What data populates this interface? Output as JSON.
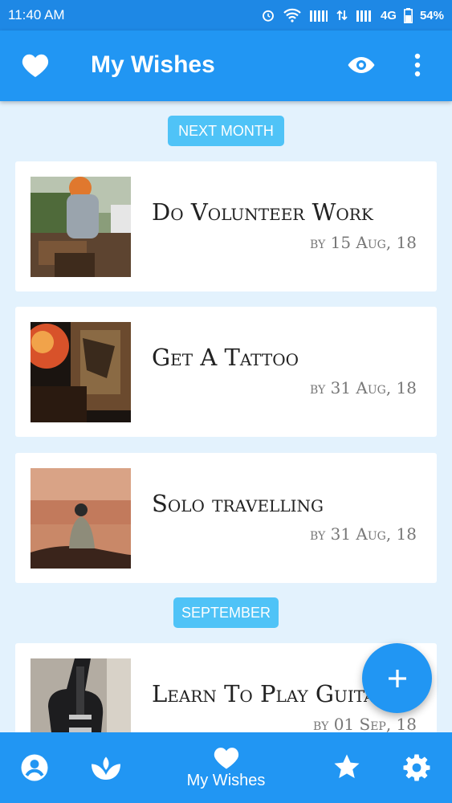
{
  "status_bar": {
    "time": "11:40 AM",
    "network": "4G",
    "battery": "54%"
  },
  "app_bar": {
    "title": "My Wishes"
  },
  "sections": [
    {
      "label": "NEXT MONTH",
      "items": [
        {
          "title": "Do Volunteer Work",
          "date": "by 15 Aug, 18"
        },
        {
          "title": "Get A Tattoo",
          "date": "by 31 Aug, 18"
        },
        {
          "title": "Solo travelling",
          "date": "by 31 Aug, 18"
        }
      ]
    },
    {
      "label": "SEPTEMBER",
      "items": [
        {
          "title": "Learn To Play Guitar",
          "date": "by 01 Sep, 18"
        }
      ]
    }
  ],
  "bottom_nav": {
    "active_label": "My Wishes"
  },
  "colors": {
    "primary": "#2196f3",
    "status_bar": "#1e88e5",
    "background": "#e3f2fd",
    "chip": "#4fc3f7"
  }
}
